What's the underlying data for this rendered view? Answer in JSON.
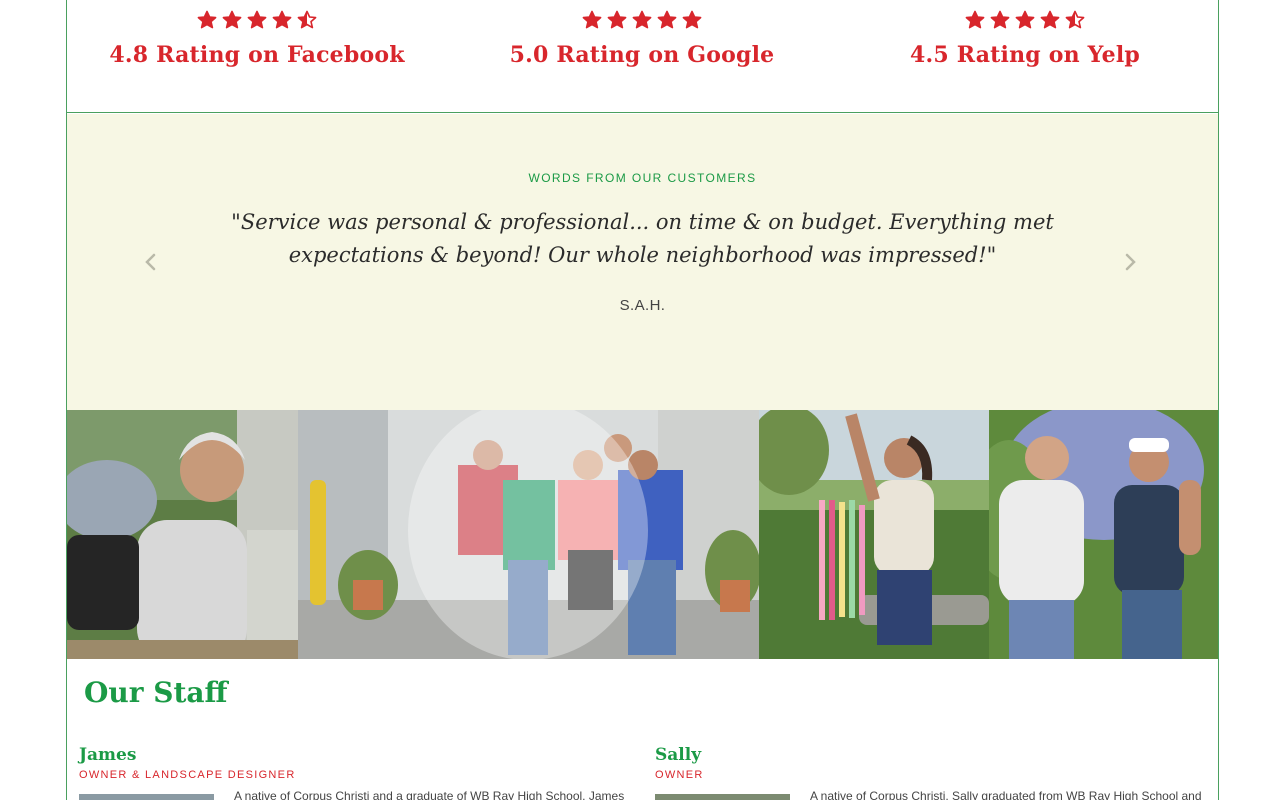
{
  "ratings": [
    {
      "label": "4.8 Rating on Facebook",
      "stars": 4.5
    },
    {
      "label": "5.0 Rating on Google",
      "stars": 5
    },
    {
      "label": "4.5 Rating on Yelp",
      "stars": 4.5
    }
  ],
  "testimonial": {
    "eyebrow": "WORDS FROM OUR CUSTOMERS",
    "quote": "\"Service was personal & professional... on time & on budget. Everything met expectations & beyond! Our whole neighborhood was impressed!\"",
    "author": "S.A.H.",
    "prev_icon": "chevron-left-icon",
    "next_icon": "chevron-right-icon"
  },
  "colors": {
    "accent_green": "#1b9a46",
    "accent_red": "#d8262c",
    "testimonial_bg": "#f7f7e4",
    "border_green": "#4aa05e"
  },
  "staff": {
    "title": "Our Staff",
    "members": [
      {
        "name": "James",
        "role": "OWNER & LANDSCAPE DESIGNER",
        "bio": "A native of Corpus Christi and a graduate of WB Ray High School, James"
      },
      {
        "name": "Sally",
        "role": "OWNER",
        "bio": "A native of Corpus Christi, Sally graduated from WB Ray High School and"
      }
    ]
  }
}
